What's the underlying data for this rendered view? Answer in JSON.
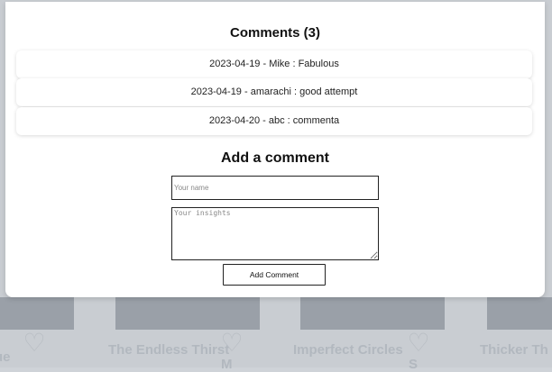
{
  "comments": {
    "title": "Comments (3)",
    "items": [
      {
        "text": "2023-04-19 - Mike : Fabulous"
      },
      {
        "text": "2023-04-19 - amarachi : good attempt"
      },
      {
        "text": "2023-04-20 - abc : commenta"
      }
    ]
  },
  "add_comment": {
    "title": "Add a comment",
    "name_placeholder": "Your name",
    "insights_placeholder": "Your insights",
    "button_label": "Add Comment"
  },
  "background": {
    "cards": [
      {
        "title": "ue"
      },
      {
        "title": "The Endless Thirst"
      },
      {
        "title": "M"
      },
      {
        "title": "Imperfect Circles"
      },
      {
        "title": "S"
      },
      {
        "title": "Thicker Th"
      }
    ]
  }
}
